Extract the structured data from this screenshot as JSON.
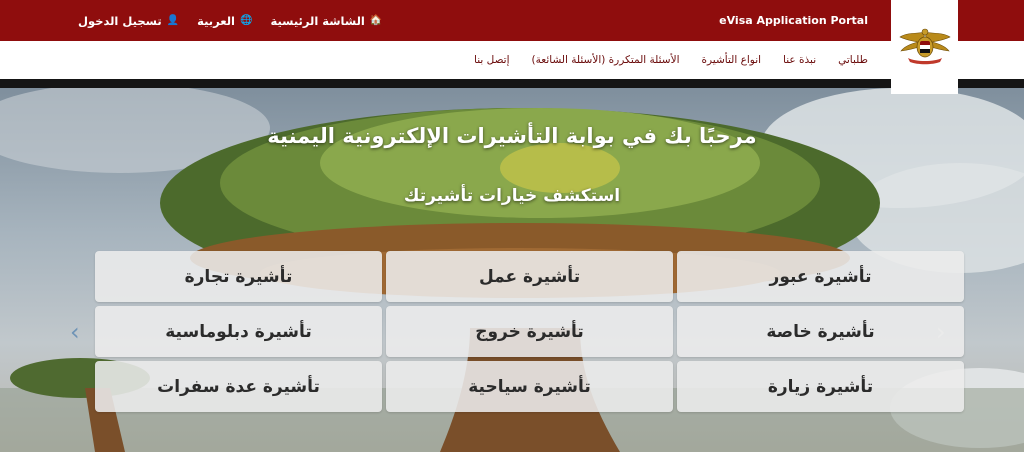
{
  "topbar": {
    "portal_title": "eVisa Application Portal",
    "links": [
      {
        "label": "الشاشة الرئيسية",
        "icon": "home-icon",
        "glyph": "🏠"
      },
      {
        "label": "العربية",
        "icon": "globe-icon",
        "glyph": "🌐"
      },
      {
        "label": "تسجيل الدخول",
        "icon": "user-circle-icon",
        "glyph": "👤"
      }
    ]
  },
  "nav": {
    "items": [
      {
        "label": "طلباتي"
      },
      {
        "label": "نبذة عنا"
      },
      {
        "label": "انواع التأشيرة"
      },
      {
        "label": "الأسئلة المتكررة (الأسئلة الشائعة)"
      },
      {
        "label": "إتصل بنا"
      }
    ]
  },
  "hero": {
    "welcome": "مرحبًا بك في بوابة التأشيرات الإلكترونية اليمنية",
    "subtitle": "استكشف خيارات تأشيرتك",
    "visa_options": [
      {
        "label": "تأشيرة عبور"
      },
      {
        "label": "تأشيرة عمل"
      },
      {
        "label": "تأشيرة تجارة"
      },
      {
        "label": "تأشيرة خاصة"
      },
      {
        "label": "تأشيرة خروج"
      },
      {
        "label": "تأشيرة دبلوماسية"
      },
      {
        "label": "تأشيرة زيارة"
      },
      {
        "label": "تأشيرة سياحية"
      },
      {
        "label": "تأشيرة عدة سفرات"
      }
    ]
  },
  "colors": {
    "brand_red": "#8f0d0d",
    "nav_text": "#6b0c0c",
    "button_bg": "#ececec"
  },
  "carousel": {
    "prev_icon": "chevron-left-icon",
    "next_icon": "chevron-right-icon"
  },
  "logo": {
    "icon": "yemen-emblem-icon"
  }
}
